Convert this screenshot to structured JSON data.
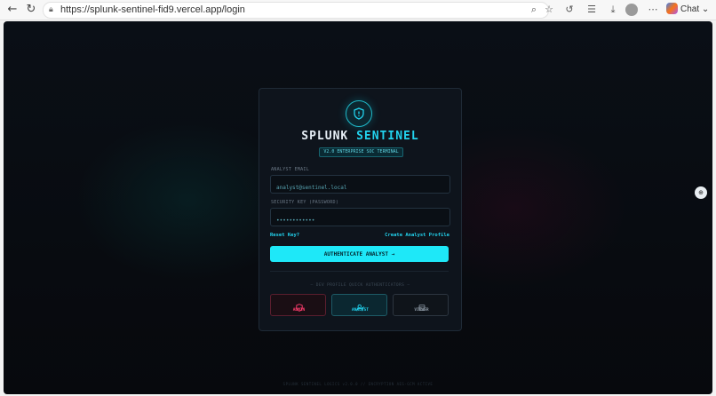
{
  "browser": {
    "url": "https://splunk-sentinel-fid9.vercel.app/login",
    "chat_label": "Chat"
  },
  "login": {
    "brand_primary": "SPLUNK",
    "brand_accent": "SENTINEL",
    "version_badge": "V2.0 ENTERPRISE SOC TERMINAL",
    "email_label": "ANALYST EMAIL",
    "email_placeholder": "analyst@sentinel.local",
    "password_label": "SECURITY KEY (PASSWORD)",
    "password_value": "••••••••••••",
    "reset_link": "Reset Key?",
    "create_link": "Create Analyst Profile",
    "submit_label": "AUTHENTICATE ANALYST →",
    "quick_auth_label": "— DEV PROFILE QUICK AUTHENTICATORS —",
    "roles": [
      {
        "label": "ADMIN",
        "icon": "shield-icon",
        "color": "#ff3d6e"
      },
      {
        "label": "ANALYST",
        "icon": "user-icon",
        "color": "#22d3ee"
      },
      {
        "label": "VIEWER",
        "icon": "database-icon",
        "color": "#8b97a3"
      }
    ],
    "footer": "SPLUNK SENTINEL LOGICS v2.0.0 // ENCRYPTION AES-GCM ACTIVE"
  },
  "colors": {
    "accent": "#22d3ee",
    "background": "#07090d",
    "admin": "#ff3d6e"
  }
}
